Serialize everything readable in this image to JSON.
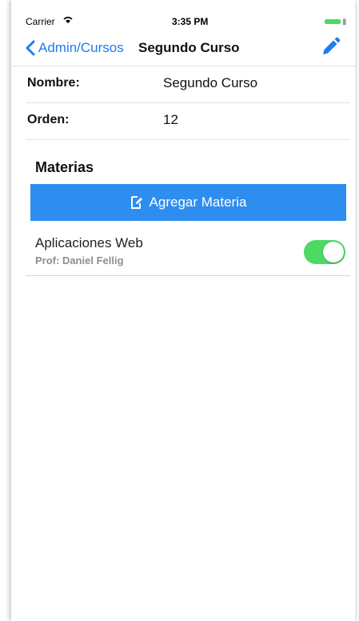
{
  "status_bar": {
    "carrier": "Carrier",
    "time": "3:35 PM"
  },
  "navbar": {
    "back_label": "Admin/Cursos",
    "title": "Segundo Curso",
    "edit_icon": "pencil-icon",
    "back_icon": "chevron-left-icon"
  },
  "details": [
    {
      "label": "Nombre:",
      "value": "Segundo Curso"
    },
    {
      "label": "Orden:",
      "value": "12"
    }
  ],
  "materias": {
    "section_title": "Materias",
    "add_button_label": "Agregar Materia",
    "add_button_icon": "edit-document-icon",
    "items": [
      {
        "name": "Aplicaciones Web",
        "professor": "Prof: Daniel Fellig",
        "enabled": true
      }
    ]
  },
  "colors": {
    "accent": "#1e7cf0",
    "button_bg": "#2d8ef0",
    "toggle_on": "#4cd964"
  }
}
